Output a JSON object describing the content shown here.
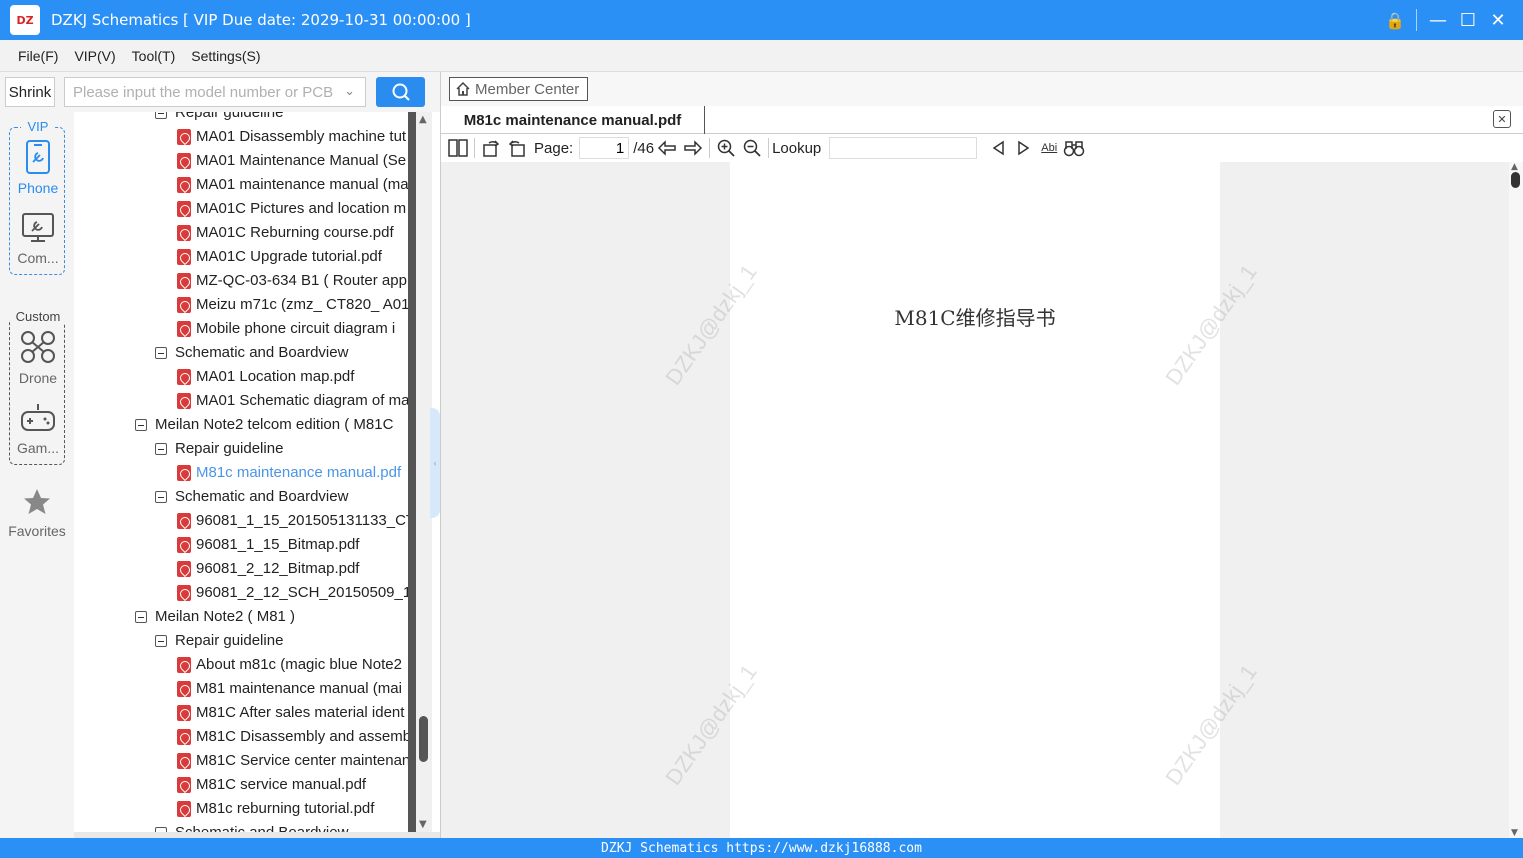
{
  "window": {
    "title": "DZKJ Schematics [ VIP Due date: 2029-10-31 00:00:00 ]",
    "logo_text": "DZ"
  },
  "menu": [
    "File(F)",
    "VIP(V)",
    "Tool(T)",
    "Settings(S)"
  ],
  "search": {
    "shrink_label": "Shrink",
    "placeholder": "Please input the model number or PCB"
  },
  "nav": {
    "vip_label": "VIP",
    "custom_label": "Custom",
    "phone": "Phone",
    "computer": "Com...",
    "drone": "Drone",
    "game": "Gam...",
    "favorites": "Favorites"
  },
  "tree": [
    {
      "level": 1,
      "type": "folder",
      "label": "Repair guideline"
    },
    {
      "level": 2,
      "type": "pdf",
      "label": "MA01 Disassembly machine tut"
    },
    {
      "level": 2,
      "type": "pdf",
      "label": "MA01 Maintenance Manual (Se"
    },
    {
      "level": 2,
      "type": "pdf",
      "label": "MA01 maintenance manual (ma"
    },
    {
      "level": 2,
      "type": "pdf",
      "label": "MA01C Pictures and location m"
    },
    {
      "level": 2,
      "type": "pdf",
      "label": "MA01C Reburning course.pdf"
    },
    {
      "level": 2,
      "type": "pdf",
      "label": "MA01C Upgrade tutorial.pdf"
    },
    {
      "level": 2,
      "type": "pdf",
      "label": "MZ-QC-03-634 B1 ( Router app"
    },
    {
      "level": 2,
      "type": "pdf",
      "label": "Meizu m71c (zmz_ CT820_ A01)"
    },
    {
      "level": 2,
      "type": "pdf",
      "label": "Mobile phone circuit diagram i"
    },
    {
      "level": 1,
      "type": "folder",
      "label": "Schematic and Boardview"
    },
    {
      "level": 2,
      "type": "pdf",
      "label": "MA01 Location map.pdf"
    },
    {
      "level": 2,
      "type": "pdf",
      "label": "MA01 Schematic diagram of ma"
    },
    {
      "level": 0,
      "type": "folder",
      "label": "Meilan Note2 telcom edition ( M81C"
    },
    {
      "level": 1,
      "type": "folder",
      "label": "Repair guideline"
    },
    {
      "level": 2,
      "type": "pdf",
      "label": "M81c maintenance manual.pdf",
      "selected": true
    },
    {
      "level": 1,
      "type": "folder",
      "label": "Schematic and Boardview"
    },
    {
      "level": 2,
      "type": "pdf",
      "label": "96081_1_15_201505131133_CT_v"
    },
    {
      "level": 2,
      "type": "pdf",
      "label": "96081_1_15_Bitmap.pdf"
    },
    {
      "level": 2,
      "type": "pdf",
      "label": "96081_2_12_Bitmap.pdf"
    },
    {
      "level": 2,
      "type": "pdf",
      "label": "96081_2_12_SCH_20150509_180"
    },
    {
      "level": 0,
      "type": "folder",
      "label": "Meilan Note2 ( M81 )"
    },
    {
      "level": 1,
      "type": "folder",
      "label": "Repair guideline"
    },
    {
      "level": 2,
      "type": "pdf",
      "label": "About m81c (magic blue Note2"
    },
    {
      "level": 2,
      "type": "pdf",
      "label": "M81 maintenance manual (mai"
    },
    {
      "level": 2,
      "type": "pdf",
      "label": "M81C After sales material ident"
    },
    {
      "level": 2,
      "type": "pdf",
      "label": "M81C Disassembly and assembl"
    },
    {
      "level": 2,
      "type": "pdf",
      "label": "M81C Service center maintenan"
    },
    {
      "level": 2,
      "type": "pdf",
      "label": "M81C service manual.pdf"
    },
    {
      "level": 2,
      "type": "pdf",
      "label": "M81c reburning tutorial.pdf"
    },
    {
      "level": 1,
      "type": "folder",
      "label": "Schematic and Boardview"
    }
  ],
  "right": {
    "member_center": "Member Center",
    "doc_tab": "M81c maintenance manual.pdf",
    "page_label": "Page:",
    "page_current": "1",
    "page_total": "/46",
    "lookup_label": "Lookup",
    "abi": "Abi"
  },
  "document": {
    "title": "M81C维修指导书",
    "watermark": "DZKJ@dzkj_1"
  },
  "status": "DZKJ Schematics https://www.dzkj16888.com",
  "colors": {
    "accent": "#2b90f5",
    "selected_text": "#4a95e8",
    "pdf_icon": "#d93a3a"
  }
}
